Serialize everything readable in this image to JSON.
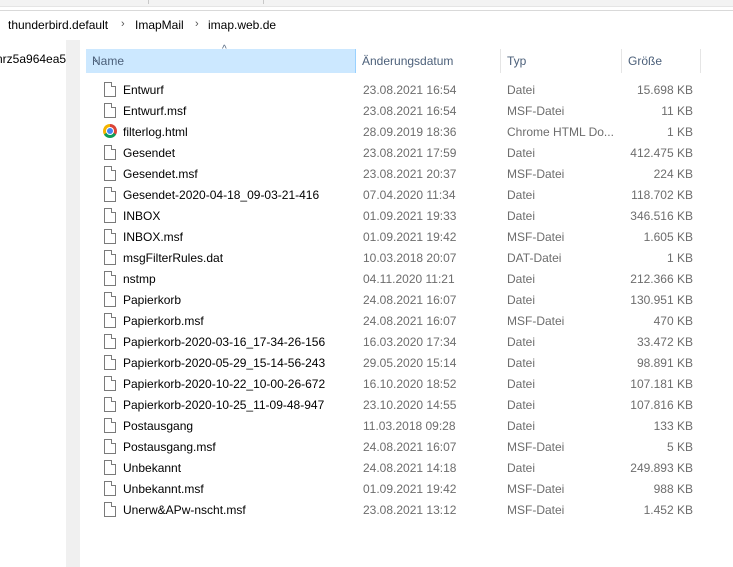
{
  "breadcrumb": [
    "thunderbird.default",
    "ImapMail",
    "imap.web.de"
  ],
  "nav": {
    "item_label": "nrz5a964ea5"
  },
  "columns": {
    "name": "Name",
    "date": "Änderungsdatum",
    "type": "Typ",
    "size": "Größe"
  },
  "sort": {
    "column": "Name",
    "direction": "ascending"
  },
  "files": [
    {
      "name": "Entwurf",
      "date": "23.08.2021 16:54",
      "type": "Datei",
      "size": "15.698 KB",
      "icon": "file-icon"
    },
    {
      "name": "Entwurf.msf",
      "date": "23.08.2021 16:54",
      "type": "MSF-Datei",
      "size": "11 KB",
      "icon": "file-icon"
    },
    {
      "name": "filterlog.html",
      "date": "28.09.2019 18:36",
      "type": "Chrome HTML Do...",
      "size": "1 KB",
      "icon": "chrome-icon"
    },
    {
      "name": "Gesendet",
      "date": "23.08.2021 17:59",
      "type": "Datei",
      "size": "412.475 KB",
      "icon": "file-icon"
    },
    {
      "name": "Gesendet.msf",
      "date": "23.08.2021 20:37",
      "type": "MSF-Datei",
      "size": "224 KB",
      "icon": "file-icon"
    },
    {
      "name": "Gesendet-2020-04-18_09-03-21-416",
      "date": "07.04.2020 11:34",
      "type": "Datei",
      "size": "118.702 KB",
      "icon": "file-icon"
    },
    {
      "name": "INBOX",
      "date": "01.09.2021 19:33",
      "type": "Datei",
      "size": "346.516 KB",
      "icon": "file-icon"
    },
    {
      "name": "INBOX.msf",
      "date": "01.09.2021 19:42",
      "type": "MSF-Datei",
      "size": "1.605 KB",
      "icon": "file-icon"
    },
    {
      "name": "msgFilterRules.dat",
      "date": "10.03.2018 20:07",
      "type": "DAT-Datei",
      "size": "1 KB",
      "icon": "file-icon"
    },
    {
      "name": "nstmp",
      "date": "04.11.2020 11:21",
      "type": "Datei",
      "size": "212.366 KB",
      "icon": "file-icon"
    },
    {
      "name": "Papierkorb",
      "date": "24.08.2021 16:07",
      "type": "Datei",
      "size": "130.951 KB",
      "icon": "file-icon"
    },
    {
      "name": "Papierkorb.msf",
      "date": "24.08.2021 16:07",
      "type": "MSF-Datei",
      "size": "470 KB",
      "icon": "file-icon"
    },
    {
      "name": "Papierkorb-2020-03-16_17-34-26-156",
      "date": "16.03.2020 17:34",
      "type": "Datei",
      "size": "33.472 KB",
      "icon": "file-icon"
    },
    {
      "name": "Papierkorb-2020-05-29_15-14-56-243",
      "date": "29.05.2020 15:14",
      "type": "Datei",
      "size": "98.891 KB",
      "icon": "file-icon"
    },
    {
      "name": "Papierkorb-2020-10-22_10-00-26-672",
      "date": "16.10.2020 18:52",
      "type": "Datei",
      "size": "107.181 KB",
      "icon": "file-icon"
    },
    {
      "name": "Papierkorb-2020-10-25_11-09-48-947",
      "date": "23.10.2020 14:55",
      "type": "Datei",
      "size": "107.816 KB",
      "icon": "file-icon"
    },
    {
      "name": "Postausgang",
      "date": "11.03.2018 09:28",
      "type": "Datei",
      "size": "133 KB",
      "icon": "file-icon"
    },
    {
      "name": "Postausgang.msf",
      "date": "24.08.2021 16:07",
      "type": "MSF-Datei",
      "size": "5 KB",
      "icon": "file-icon"
    },
    {
      "name": "Unbekannt",
      "date": "24.08.2021 14:18",
      "type": "Datei",
      "size": "249.893 KB",
      "icon": "file-icon"
    },
    {
      "name": "Unbekannt.msf",
      "date": "01.09.2021 19:42",
      "type": "MSF-Datei",
      "size": "988 KB",
      "icon": "file-icon"
    },
    {
      "name": "Unerw&APw-nscht.msf",
      "date": "23.08.2021 13:12",
      "type": "MSF-Datei",
      "size": "1.452 KB",
      "icon": "file-icon"
    }
  ]
}
